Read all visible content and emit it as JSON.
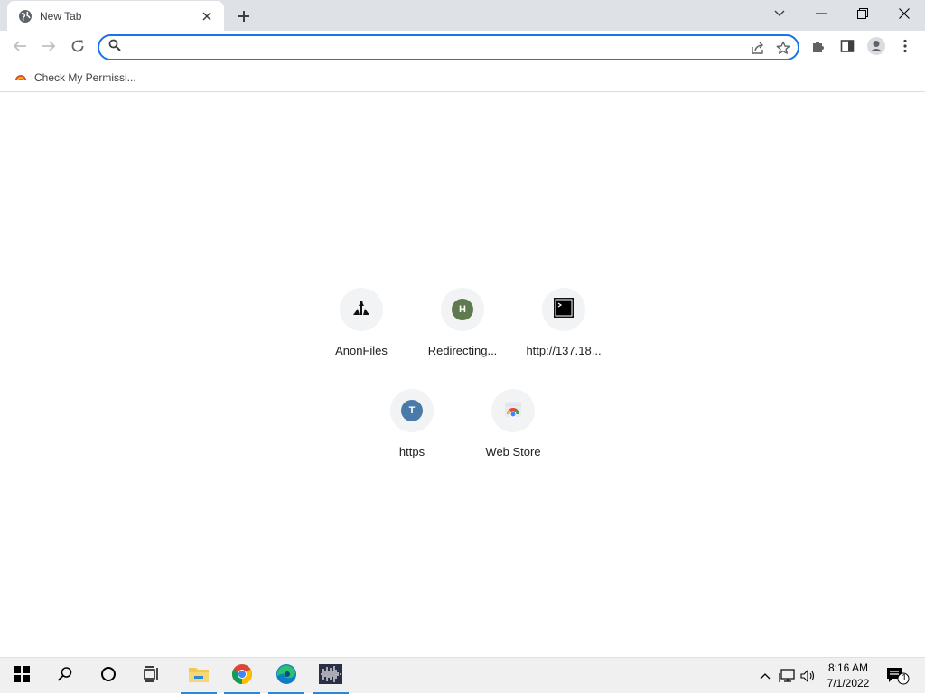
{
  "tab": {
    "title": "New Tab"
  },
  "omnibox": {
    "value": "",
    "placeholder": ""
  },
  "bookmarks": [
    {
      "label": "Check My Permissi..."
    }
  ],
  "shortcuts": [
    {
      "title": "AnonFiles",
      "icon": "anonfiles-logo-icon"
    },
    {
      "title": "Redirecting...",
      "icon": "letter-h-icon",
      "letter": "H",
      "color": "#5f7a4f"
    },
    {
      "title": "http://137.18...",
      "icon": "terminal-icon"
    },
    {
      "title": "https",
      "icon": "letter-t-icon",
      "letter": "T",
      "color": "#4a7aa8"
    },
    {
      "title": "Web Store",
      "icon": "web-store-icon"
    }
  ],
  "taskbar": {
    "clock_time": "8:16 AM",
    "clock_date": "7/1/2022",
    "notification_count": "1"
  },
  "colors": {
    "accent": "#1a73e8",
    "tabstrip": "#dee1e6"
  }
}
